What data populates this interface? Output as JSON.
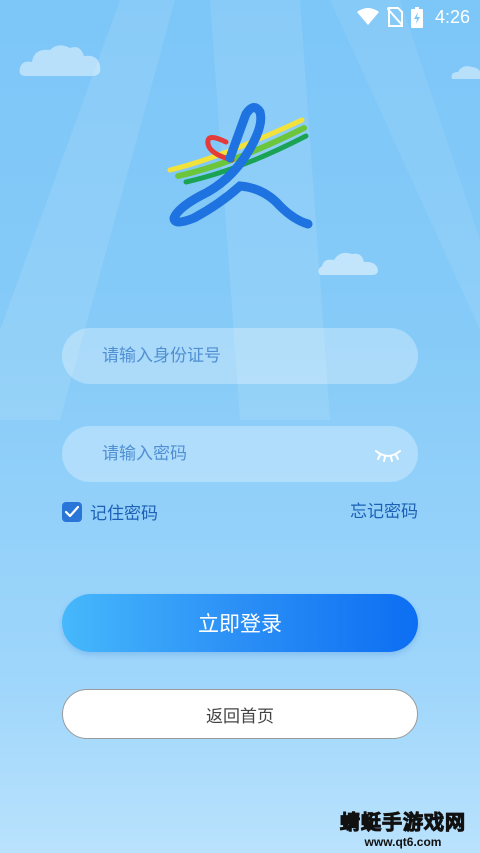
{
  "status_bar": {
    "time": "4:26",
    "icons": [
      "wifi-icon",
      "no-sim-icon",
      "battery-charging-icon"
    ]
  },
  "login": {
    "id_placeholder": "请输入身份证号",
    "password_placeholder": "请输入密码",
    "remember_label": "记住密码",
    "remember_checked": true,
    "forgot_label": "忘记密码",
    "login_button": "立即登录",
    "home_button": "返回首页"
  },
  "watermark": {
    "title": "蜻蜓手游戏网",
    "url": "www.qt6.com"
  },
  "colors": {
    "accent": "#0c6ef2",
    "link": "#1c5fb5",
    "background": "#86cbf8"
  }
}
